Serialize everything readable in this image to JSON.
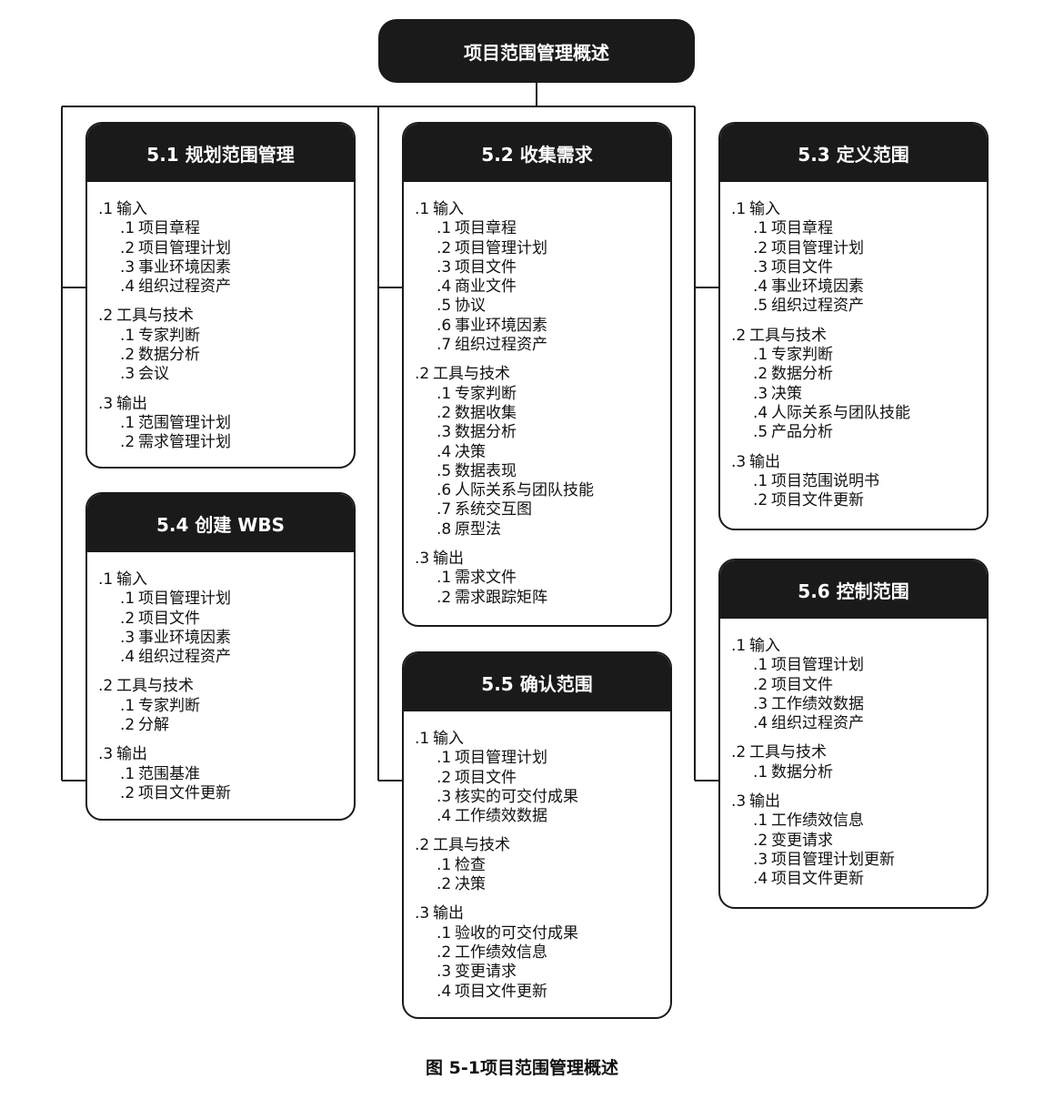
{
  "root": {
    "title": "项目范围管理概述"
  },
  "caption": "图 5-1项目范围管理概述",
  "processes": [
    {
      "title": "5.1 规划范围管理",
      "groups": [
        {
          "num": ".1",
          "label": "输入",
          "items": [
            {
              "num": ".1",
              "label": "项目章程"
            },
            {
              "num": ".2",
              "label": "项目管理计划"
            },
            {
              "num": ".3",
              "label": "事业环境因素"
            },
            {
              "num": ".4",
              "label": "组织过程资产"
            }
          ]
        },
        {
          "num": ".2",
          "label": "工具与技术",
          "items": [
            {
              "num": ".1",
              "label": "专家判断"
            },
            {
              "num": ".2",
              "label": "数据分析"
            },
            {
              "num": ".3",
              "label": "会议"
            }
          ]
        },
        {
          "num": ".3",
          "label": "输出",
          "items": [
            {
              "num": ".1",
              "label": "范围管理计划"
            },
            {
              "num": ".2",
              "label": "需求管理计划"
            }
          ]
        }
      ]
    },
    {
      "title": "5.2 收集需求",
      "groups": [
        {
          "num": ".1",
          "label": "输入",
          "items": [
            {
              "num": ".1",
              "label": "项目章程"
            },
            {
              "num": ".2",
              "label": "项目管理计划"
            },
            {
              "num": ".3",
              "label": "项目文件"
            },
            {
              "num": ".4",
              "label": "商业文件"
            },
            {
              "num": ".5",
              "label": "协议"
            },
            {
              "num": ".6",
              "label": "事业环境因素"
            },
            {
              "num": ".7",
              "label": "组织过程资产"
            }
          ]
        },
        {
          "num": ".2",
          "label": "工具与技术",
          "items": [
            {
              "num": ".1",
              "label": "专家判断"
            },
            {
              "num": ".2",
              "label": "数据收集"
            },
            {
              "num": ".3",
              "label": "数据分析"
            },
            {
              "num": ".4",
              "label": "决策"
            },
            {
              "num": ".5",
              "label": "数据表现"
            },
            {
              "num": ".6",
              "label": "人际关系与团队技能"
            },
            {
              "num": ".7",
              "label": "系统交互图"
            },
            {
              "num": ".8",
              "label": "原型法"
            }
          ]
        },
        {
          "num": ".3",
          "label": "输出",
          "items": [
            {
              "num": ".1",
              "label": "需求文件"
            },
            {
              "num": ".2",
              "label": "需求跟踪矩阵"
            }
          ]
        }
      ]
    },
    {
      "title": "5.3 定义范围",
      "groups": [
        {
          "num": ".1",
          "label": "输入",
          "items": [
            {
              "num": ".1",
              "label": "项目章程"
            },
            {
              "num": ".2",
              "label": "项目管理计划"
            },
            {
              "num": ".3",
              "label": "项目文件"
            },
            {
              "num": ".4",
              "label": "事业环境因素"
            },
            {
              "num": ".5",
              "label": "组织过程资产"
            }
          ]
        },
        {
          "num": ".2",
          "label": "工具与技术",
          "items": [
            {
              "num": ".1",
              "label": "专家判断"
            },
            {
              "num": ".2",
              "label": "数据分析"
            },
            {
              "num": ".3",
              "label": "决策"
            },
            {
              "num": ".4",
              "label": "人际关系与团队技能"
            },
            {
              "num": ".5",
              "label": "产品分析"
            }
          ]
        },
        {
          "num": ".3",
          "label": "输出",
          "items": [
            {
              "num": ".1",
              "label": "项目范围说明书"
            },
            {
              "num": ".2",
              "label": "项目文件更新"
            }
          ]
        }
      ]
    },
    {
      "title": "5.4 创建 WBS",
      "groups": [
        {
          "num": ".1",
          "label": "输入",
          "items": [
            {
              "num": ".1",
              "label": "项目管理计划"
            },
            {
              "num": ".2",
              "label": "项目文件"
            },
            {
              "num": ".3",
              "label": "事业环境因素"
            },
            {
              "num": ".4",
              "label": "组织过程资产"
            }
          ]
        },
        {
          "num": ".2",
          "label": "工具与技术",
          "items": [
            {
              "num": ".1",
              "label": "专家判断"
            },
            {
              "num": ".2",
              "label": "分解"
            }
          ]
        },
        {
          "num": ".3",
          "label": "输出",
          "items": [
            {
              "num": ".1",
              "label": "范围基准"
            },
            {
              "num": ".2",
              "label": "项目文件更新"
            }
          ]
        }
      ]
    },
    {
      "title": "5.5 确认范围",
      "groups": [
        {
          "num": ".1",
          "label": "输入",
          "items": [
            {
              "num": ".1",
              "label": "项目管理计划"
            },
            {
              "num": ".2",
              "label": "项目文件"
            },
            {
              "num": ".3",
              "label": "核实的可交付成果"
            },
            {
              "num": ".4",
              "label": "工作绩效数据"
            }
          ]
        },
        {
          "num": ".2",
          "label": "工具与技术",
          "items": [
            {
              "num": ".1",
              "label": "检查"
            },
            {
              "num": ".2",
              "label": "决策"
            }
          ]
        },
        {
          "num": ".3",
          "label": "输出",
          "items": [
            {
              "num": ".1",
              "label": "验收的可交付成果"
            },
            {
              "num": ".2",
              "label": "工作绩效信息"
            },
            {
              "num": ".3",
              "label": "变更请求"
            },
            {
              "num": ".4",
              "label": "项目文件更新"
            }
          ]
        }
      ]
    },
    {
      "title": "5.6 控制范围",
      "groups": [
        {
          "num": ".1",
          "label": "输入",
          "items": [
            {
              "num": ".1",
              "label": "项目管理计划"
            },
            {
              "num": ".2",
              "label": "项目文件"
            },
            {
              "num": ".3",
              "label": "工作绩效数据"
            },
            {
              "num": ".4",
              "label": "组织过程资产"
            }
          ]
        },
        {
          "num": ".2",
          "label": "工具与技术",
          "items": [
            {
              "num": ".1",
              "label": "数据分析"
            }
          ]
        },
        {
          "num": ".3",
          "label": "输出",
          "items": [
            {
              "num": ".1",
              "label": "工作绩效信息"
            },
            {
              "num": ".2",
              "label": "变更请求"
            },
            {
              "num": ".3",
              "label": "项目管理计划更新"
            },
            {
              "num": ".4",
              "label": "项目文件更新"
            }
          ]
        }
      ]
    }
  ]
}
